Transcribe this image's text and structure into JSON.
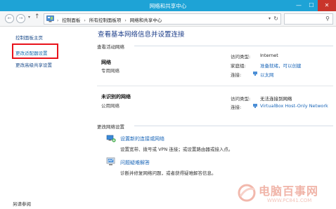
{
  "window": {
    "title": "网络和共享中心",
    "min": "—",
    "max": "☐",
    "close": "✕"
  },
  "nav": {
    "back": "←",
    "forward": "→",
    "down": "▾",
    "up": "↑",
    "breadcrumbs": [
      "控制面板",
      "所有控制面板项",
      "网络和共享中心"
    ],
    "separator": "›",
    "dropdown": "▾",
    "refresh": "↻",
    "search_icon": "⚲"
  },
  "sidebar": {
    "home": "控制面板主页",
    "adapter": "更改适配器设置",
    "sharing": "更改高级共享设置",
    "see_also": "另请参阅"
  },
  "main": {
    "title": "查看基本网络信息并设置连接",
    "active_networks": "查看活动网络",
    "networks": [
      {
        "name": "网络",
        "type": "专用网络",
        "access_label": "访问类型:",
        "access_value": "Internet",
        "homegroup_label": "家庭组:",
        "homegroup_value": "准备就绪，可以创建",
        "conn_label": "连接:",
        "conn_value": "以太网"
      },
      {
        "name": "未识别的网络",
        "type": "公用网络",
        "access_label": "访问类型:",
        "access_value": "无法连接到网络",
        "conn_label": "连接:",
        "conn_value": "VirtualBox Host-Only Network"
      }
    ],
    "change_settings": "更改网络设置",
    "tasks": [
      {
        "link": "设置新的连接或网络",
        "desc": "设置宽带、拨号或 VPN 连接；或设置路由器或接入点。"
      },
      {
        "link": "问题疑难解答",
        "desc": "诊断并修复网络问题，或者获得疑难解答信息。"
      }
    ]
  },
  "watermark": {
    "name": "电脑百事网",
    "url": "WWW.PC841.COM"
  },
  "colors": {
    "titlebar": "#1ea3d6",
    "link": "#1a66b8",
    "highlight": "#e8121b"
  }
}
